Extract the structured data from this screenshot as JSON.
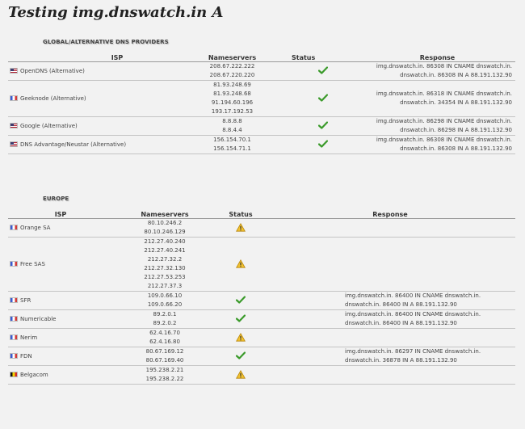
{
  "title": "Testing img.dnswatch.in A",
  "columns": {
    "isp": "ISP",
    "nameservers": "Nameservers",
    "status": "Status",
    "response": "Response"
  },
  "sections": [
    {
      "title": "GLOBAL/ALTERNATIVE DNS PROVIDERS",
      "rows": [
        {
          "flag": "us",
          "isp": "OpenDNS (Alternative)",
          "nameservers": [
            "208.67.222.222",
            "208.67.220.220"
          ],
          "status": "ok",
          "response": [
            "img.dnswatch.in. 86308 IN CNAME dnswatch.in.",
            "dnswatch.in. 86308 IN A 88.191.132.90"
          ]
        },
        {
          "flag": "fr",
          "isp": "Geeknode (Alternative)",
          "nameservers": [
            "81.93.248.69",
            "81.93.248.68",
            "91.194.60.196",
            "193.17.192.53"
          ],
          "status": "ok",
          "response": [
            "img.dnswatch.in. 86318 IN CNAME dnswatch.in.",
            "dnswatch.in. 34354 IN A 88.191.132.90"
          ]
        },
        {
          "flag": "us",
          "isp": "Google (Alternative)",
          "nameservers": [
            "8.8.8.8",
            "8.8.4.4"
          ],
          "status": "ok",
          "response": [
            "img.dnswatch.in. 86298 IN CNAME dnswatch.in.",
            "dnswatch.in. 86298 IN A 88.191.132.90"
          ]
        },
        {
          "flag": "us",
          "isp": "DNS Advantage/Neustar (Alternative)",
          "nameservers": [
            "156.154.70.1",
            "156.154.71.1"
          ],
          "status": "ok",
          "response": [
            "img.dnswatch.in. 86308 IN CNAME dnswatch.in.",
            "dnswatch.in. 86308 IN A 88.191.132.90"
          ]
        }
      ]
    },
    {
      "title": "EUROPE",
      "rows": [
        {
          "flag": "fr",
          "isp": "Orange SA",
          "nameservers": [
            "80.10.246.2",
            "80.10.246.129"
          ],
          "status": "warn",
          "response": []
        },
        {
          "flag": "fr",
          "isp": "Free SAS",
          "nameservers": [
            "212.27.40.240",
            "212.27.40.241",
            "212.27.32.2",
            "212.27.32.130",
            "212.27.53.253",
            "212.27.37.3"
          ],
          "status": "warn",
          "response": []
        },
        {
          "flag": "fr",
          "isp": "SFR",
          "nameservers": [
            "109.0.66.10",
            "109.0.66.20"
          ],
          "status": "ok",
          "response": [
            "img.dnswatch.in. 86400 IN CNAME dnswatch.in.",
            "dnswatch.in. 86400 IN A 88.191.132.90"
          ]
        },
        {
          "flag": "fr",
          "isp": "Numericable",
          "nameservers": [
            "89.2.0.1",
            "89.2.0.2"
          ],
          "status": "ok",
          "response": [
            "img.dnswatch.in. 86400 IN CNAME dnswatch.in.",
            "dnswatch.in. 86400 IN A 88.191.132.90"
          ]
        },
        {
          "flag": "fr",
          "isp": "Nerim",
          "nameservers": [
            "62.4.16.70",
            "62.4.16.80"
          ],
          "status": "warn",
          "response": []
        },
        {
          "flag": "fr",
          "isp": "FDN",
          "nameservers": [
            "80.67.169.12",
            "80.67.169.40"
          ],
          "status": "ok",
          "response": [
            "img.dnswatch.in. 86297 IN CNAME dnswatch.in.",
            "dnswatch.in. 36878 IN A 88.191.132.90"
          ]
        },
        {
          "flag": "be",
          "isp": "Belgacom",
          "nameservers": [
            "195.238.2.21",
            "195.238.2.22"
          ],
          "status": "warn",
          "response": []
        }
      ]
    }
  ]
}
